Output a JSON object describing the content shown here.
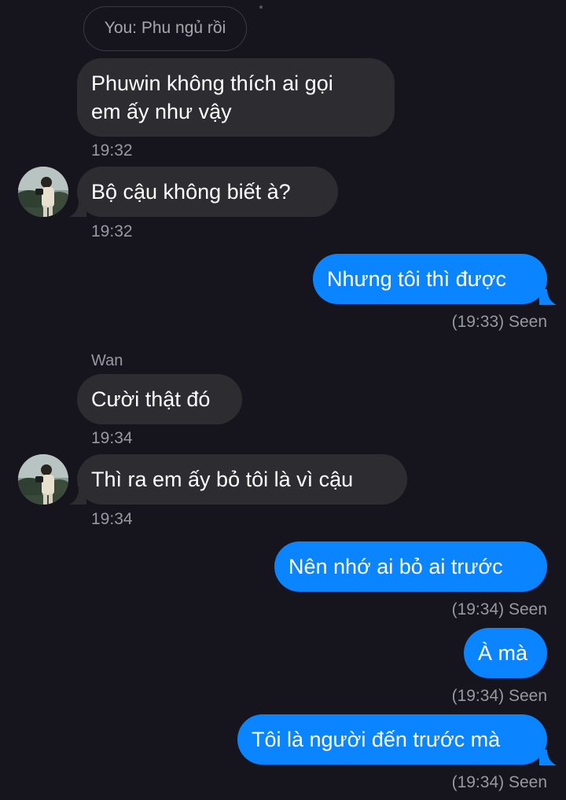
{
  "reply_preview": "You: Phu ngủ rồi",
  "messages": [
    {
      "text_line1": "Phuwin không thích ai gọi",
      "text_line2": "em ấy như vậy",
      "time": "19:32"
    },
    {
      "text": "Bộ cậu không biết à?",
      "time": "19:32"
    },
    {
      "text": "Nhưng tôi thì được",
      "status": "(19:33) Seen"
    },
    {
      "sender": "Wan",
      "text": "Cười thật đó",
      "time": "19:34"
    },
    {
      "text": "Thì ra em ấy bỏ tôi là vì cậu",
      "time": "19:34"
    },
    {
      "text": "Nên nhớ ai bỏ ai trước",
      "status": "(19:34) Seen"
    },
    {
      "text": "À mà",
      "status": "(19:34) Seen"
    },
    {
      "text": "Tôi là người đến trước mà",
      "status": "(19:34) Seen"
    }
  ],
  "colors": {
    "background": "#16151d",
    "incoming_bubble": "#2c2c31",
    "outgoing_bubble": "#0a84ff",
    "meta_text": "#98989f"
  },
  "icons": {
    "avatar": "profile-photo-avatar"
  }
}
